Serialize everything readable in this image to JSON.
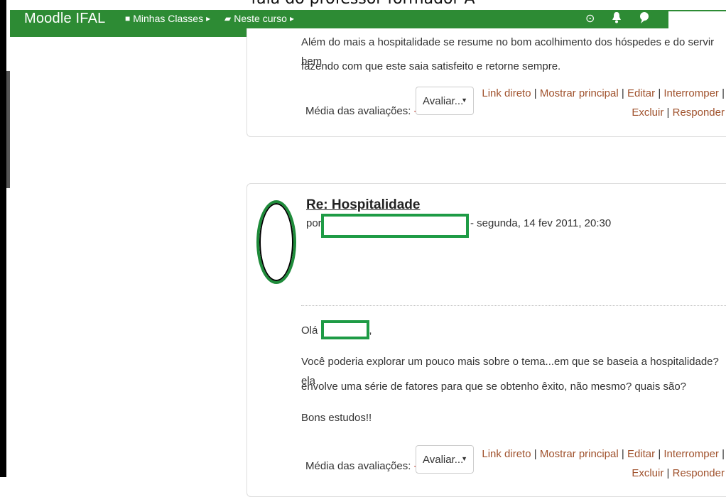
{
  "caption": "fala do professor formador A",
  "navbar": {
    "brand": "Moodle IFAL",
    "my_classes": "Minhas Classes",
    "this_course": "Neste curso"
  },
  "post1": {
    "body_line1": "Além do mais a hospitalidade se resume no bom acolhimento dos hóspedes e do servir bem",
    "body_line2": "fazendo com que este saia satisfeito e retorne sempre.",
    "rating_label": "Média das avaliações:",
    "rating_dash": "-",
    "rate_select": "Avaliar...",
    "commands": {
      "permalink": "Link direto",
      "show_parent": "Mostrar principal",
      "edit": "Editar",
      "split": "Interromper",
      "delete": "Excluir",
      "reply": "Responder"
    }
  },
  "post2": {
    "subject": "Re: Hospitalidade",
    "by_prefix": "por",
    "date": "- segunda, 14 fev 2011, 20:30",
    "greeting": "Olá",
    "greeting_suffix": ",",
    "body_line1": "Você poderia explorar um pouco mais sobre o tema...em que se baseia a hospitalidade? ela",
    "body_line2": "envolve uma série de fatores para que se obtenho êxito, não mesmo? quais são?",
    "closing": "Bons estudos!!",
    "rating_label": "Média das avaliações:",
    "rating_dash": "-",
    "rate_select": "Avaliar...",
    "commands": {
      "permalink": "Link direto",
      "show_parent": "Mostrar principal",
      "edit": "Editar",
      "split": "Interromper",
      "delete": "Excluir",
      "reply": "Responder"
    }
  },
  "colors": {
    "navbar": "#2d8b34",
    "link": "#a0522d",
    "redaction": "#1e9b45"
  }
}
